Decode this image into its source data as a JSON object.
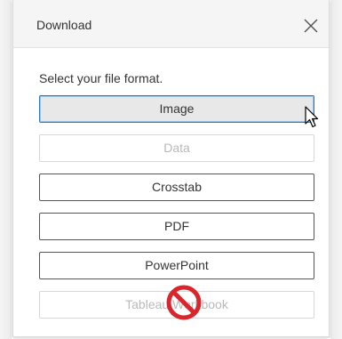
{
  "dialog": {
    "title": "Download",
    "prompt": "Select your file format."
  },
  "icons": {
    "close": "close-icon",
    "cursor": "mouse-pointer-icon",
    "not_allowed": "prohibited-icon"
  },
  "colors": {
    "selected_border": "#2f7bc0",
    "prohibited": "#d9262c"
  },
  "formats": [
    {
      "label": "Image",
      "state": "selected"
    },
    {
      "label": "Data",
      "state": "disabled"
    },
    {
      "label": "Crosstab",
      "state": "enabled"
    },
    {
      "label": "PDF",
      "state": "enabled"
    },
    {
      "label": "PowerPoint",
      "state": "enabled"
    },
    {
      "label": "Tableau Workbook",
      "state": "disabled"
    }
  ]
}
